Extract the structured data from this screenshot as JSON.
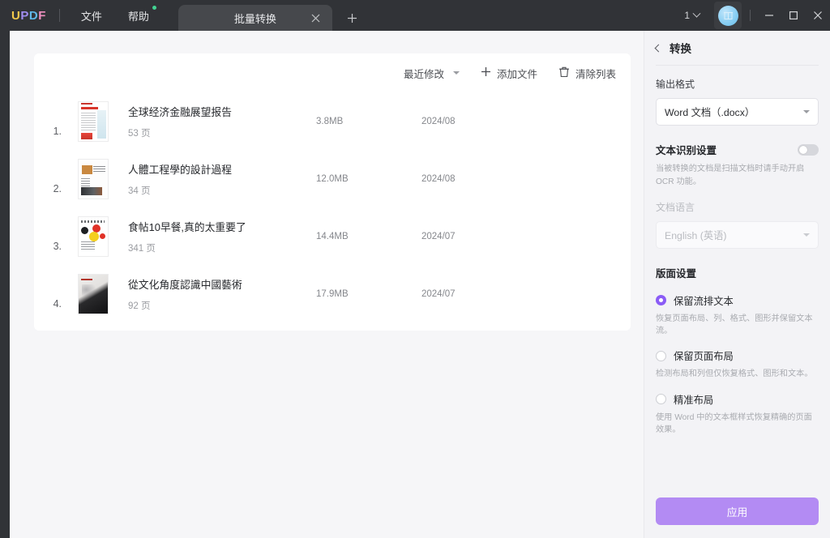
{
  "titlebar": {
    "logo": {
      "u": "U",
      "p": "P",
      "d": "D",
      "f": "F"
    },
    "menus": [
      {
        "label": "文件",
        "badge": false
      },
      {
        "label": "帮助",
        "badge": true
      }
    ],
    "tab": {
      "label": "批量转换",
      "close_icon": "close-icon"
    },
    "new_tab_label": "+",
    "page_indicator": "1",
    "window_controls": {
      "minimize": "minimize-icon",
      "maximize": "maximize-icon",
      "close": "close-icon"
    }
  },
  "toolbar": {
    "sort_label": "最近修改",
    "add_files_label": "添加文件",
    "clear_list_label": "清除列表"
  },
  "files": [
    {
      "index": "1.",
      "name": "全球经济金融展望报告",
      "pages": "53 页",
      "size": "3.8MB",
      "date": "2024/08",
      "thumb": "th-a"
    },
    {
      "index": "2.",
      "name": "人體工程學的設計過程",
      "pages": "34 页",
      "size": "12.0MB",
      "date": "2024/08",
      "thumb": "th-b"
    },
    {
      "index": "3.",
      "name": "食帖10早餐,真的太重要了",
      "pages": "341 页",
      "size": "14.4MB",
      "date": "2024/07",
      "thumb": "th-c"
    },
    {
      "index": "4.",
      "name": "從文化角度認識中國藝術",
      "pages": "92 页",
      "size": "17.9MB",
      "date": "2024/07",
      "thumb": "th-d"
    }
  ],
  "panel": {
    "title": "转换",
    "back_icon": "chevron-left-icon",
    "output_format": {
      "label": "输出格式",
      "value": "Word 文档（.docx）"
    },
    "ocr": {
      "title": "文本识别设置",
      "enabled": false,
      "hint": "当被转换的文档是扫描文档时请手动开启 OCR 功能。",
      "language_label": "文档语言",
      "language_value": "English (英语)"
    },
    "layout": {
      "title": "版面设置",
      "options": [
        {
          "label": "保留流排文本",
          "desc": "恢复页面布局、列、格式、图形并保留文本流。",
          "selected": true
        },
        {
          "label": "保留页面布局",
          "desc": "检测布局和列但仅恢复格式、图形和文本。",
          "selected": false
        },
        {
          "label": "精准布局",
          "desc": "使用 Word 中的文本框样式恢复精确的页面效果。",
          "selected": false
        }
      ]
    },
    "apply_label": "应用"
  },
  "colors": {
    "accent_purple": "#8b5cf6",
    "apply_button": "#b38bf3",
    "titlebar_bg": "#313337",
    "panel_bg": "#f3f3f6",
    "badge_green": "#42d392"
  }
}
